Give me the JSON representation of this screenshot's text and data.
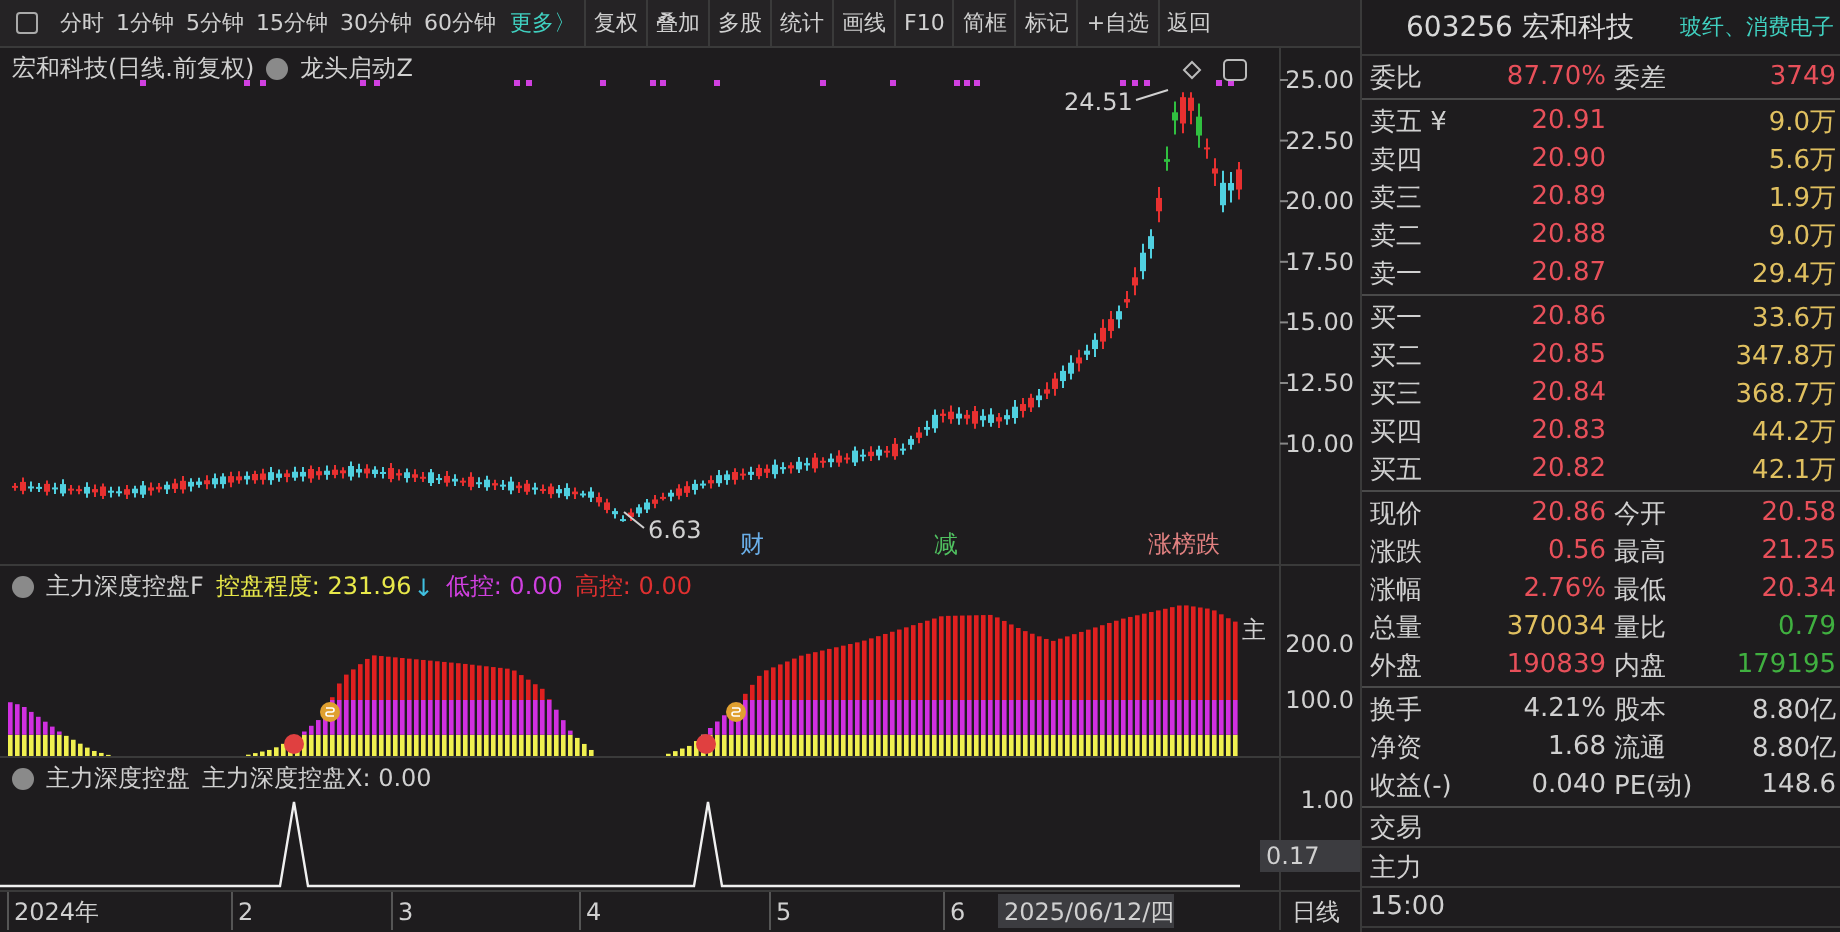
{
  "toolbar": {
    "items": [
      {
        "label": "分时",
        "kind": "period"
      },
      {
        "label": "1分钟",
        "kind": "period"
      },
      {
        "label": "5分钟",
        "kind": "period"
      },
      {
        "label": "15分钟",
        "kind": "period"
      },
      {
        "label": "30分钟",
        "kind": "period"
      },
      {
        "label": "60分钟",
        "kind": "period"
      },
      {
        "label": "更多〉",
        "kind": "more"
      },
      {
        "label": "复权",
        "kind": "button"
      },
      {
        "label": "叠加",
        "kind": "button"
      },
      {
        "label": "多股",
        "kind": "button"
      },
      {
        "label": "统计",
        "kind": "button"
      },
      {
        "label": "画线",
        "kind": "button"
      },
      {
        "label": "F10",
        "kind": "button"
      },
      {
        "label": "简框",
        "kind": "button"
      },
      {
        "label": "标记",
        "kind": "button"
      },
      {
        "label": "+自选",
        "kind": "button"
      },
      {
        "label": "返回",
        "kind": "button"
      }
    ]
  },
  "main_chart": {
    "title": "宏和科技(日线.前复权)",
    "indicator": "龙头启动Z",
    "y_ticks": [
      "25.00",
      "22.50",
      "20.00",
      "17.50",
      "15.00",
      "12.50",
      "10.00"
    ],
    "high_label": "24.51",
    "low_label": "6.63",
    "signals": [
      {
        "label": "财",
        "color": "#6aaee8"
      },
      {
        "label": "减",
        "color": "#50c060"
      },
      {
        "label": "涨榜跌",
        "color": "#e08080"
      }
    ]
  },
  "panel_f": {
    "name": "主力深度控盘F",
    "readings": [
      {
        "label": "控盘程度: 231.96",
        "color": "#e8e84a"
      },
      {
        "label": "低控: 0.00",
        "color": "#d040e0"
      },
      {
        "label": "高控: 0.00",
        "color": "#e03030"
      }
    ],
    "trend": "↓",
    "y_ticks": [
      "200.0",
      "100.0"
    ],
    "side_label": "主"
  },
  "panel_x": {
    "name": "主力深度控盘",
    "reading": "主力深度控盘X: 0.00",
    "y_ticks": [
      "1.00"
    ],
    "cursor_value": "0.17"
  },
  "x_axis": {
    "labels": [
      "2024年",
      "2",
      "3",
      "4",
      "5",
      "6"
    ],
    "cursor_date": "2025/06/12/四",
    "period": "日线"
  },
  "quote": {
    "code": "603256",
    "name": "宏和科技",
    "sectors": "玻纤、消费电子",
    "ratio": [
      {
        "label": "委比",
        "value": "87.70%",
        "color": "#e8505a"
      },
      {
        "label": "委差",
        "value": "3749",
        "color": "#e8505a"
      }
    ],
    "asks": [
      {
        "label": "卖五 ¥",
        "price": "20.91",
        "volume": "9.0万"
      },
      {
        "label": "卖四",
        "price": "20.90",
        "volume": "5.6万"
      },
      {
        "label": "卖三",
        "price": "20.89",
        "volume": "1.9万"
      },
      {
        "label": "卖二",
        "price": "20.88",
        "volume": "9.0万"
      },
      {
        "label": "卖一",
        "price": "20.87",
        "volume": "29.4万"
      }
    ],
    "bids": [
      {
        "label": "买一",
        "price": "20.86",
        "volume": "33.6万"
      },
      {
        "label": "买二",
        "price": "20.85",
        "volume": "347.8万"
      },
      {
        "label": "买三",
        "price": "20.84",
        "volume": "368.7万"
      },
      {
        "label": "买四",
        "price": "20.83",
        "volume": "44.2万"
      },
      {
        "label": "买五",
        "price": "20.82",
        "volume": "42.1万"
      }
    ],
    "stats": [
      [
        {
          "label": "现价",
          "value": "20.86",
          "color": "#e8505a"
        },
        {
          "label": "今开",
          "value": "20.58",
          "color": "#e8505a"
        }
      ],
      [
        {
          "label": "涨跌",
          "value": "0.56",
          "color": "#e8505a"
        },
        {
          "label": "最高",
          "value": "21.25",
          "color": "#e8505a"
        }
      ],
      [
        {
          "label": "涨幅",
          "value": "2.76%",
          "color": "#e8505a"
        },
        {
          "label": "最低",
          "value": "20.34",
          "color": "#e8505a"
        }
      ],
      [
        {
          "label": "总量",
          "value": "370034",
          "color": "#e0c060"
        },
        {
          "label": "量比",
          "value": "0.79",
          "color": "#40b040"
        }
      ],
      [
        {
          "label": "外盘",
          "value": "190839",
          "color": "#e8505a"
        },
        {
          "label": "内盘",
          "value": "179195",
          "color": "#40b040"
        }
      ]
    ],
    "finance": [
      [
        {
          "label": "换手",
          "value": "4.21%",
          "color": "#d0d0d0"
        },
        {
          "label": "股本",
          "value": "8.80亿",
          "color": "#d0d0d0"
        }
      ],
      [
        {
          "label": "净资",
          "value": "1.68",
          "color": "#d0d0d0"
        },
        {
          "label": "流通",
          "value": "8.80亿",
          "color": "#d0d0d0"
        }
      ],
      [
        {
          "label": "收益(-)",
          "value": "0.040",
          "color": "#d0d0d0"
        },
        {
          "label": "PE(动)",
          "value": "148.6",
          "color": "#d0d0d0"
        }
      ]
    ],
    "footer_rows": [
      "交易",
      "主力",
      "15:00"
    ]
  }
}
